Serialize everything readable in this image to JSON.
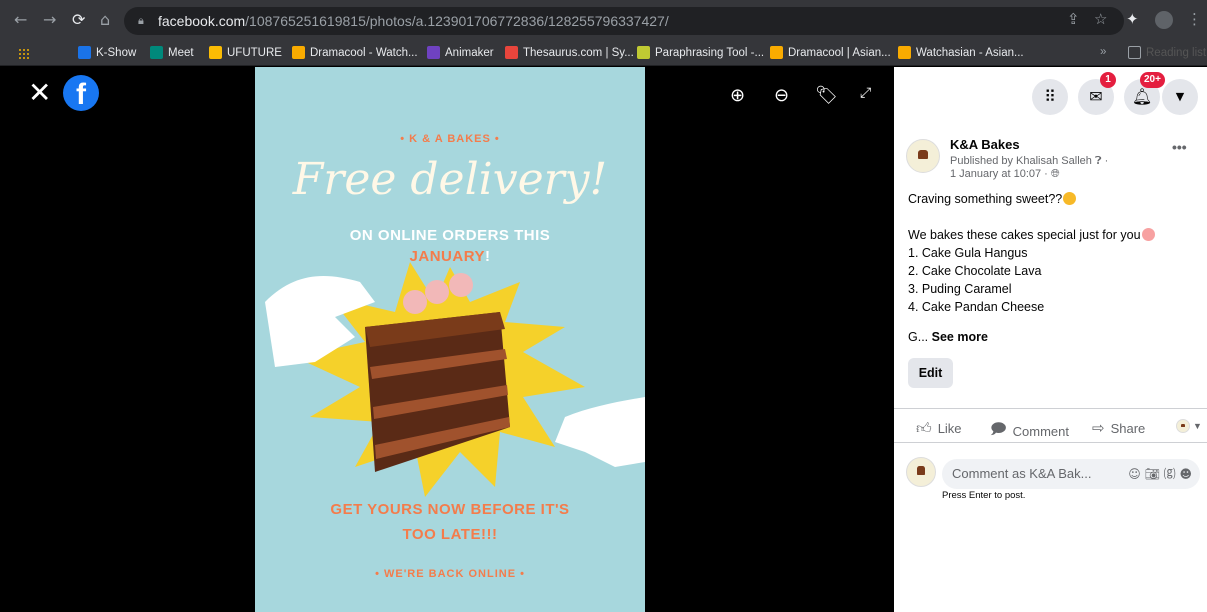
{
  "browser": {
    "url_domain": "facebook.com",
    "url_path": "/108765251619815/photos/a.123901706772836/128255796337427/",
    "bookmarks": [
      {
        "label": "Apps",
        "color": "#f4b400"
      },
      {
        "label": "K-Show",
        "color": "#1a73e8"
      },
      {
        "label": "Meet",
        "color": "#00897b"
      },
      {
        "label": "UFUTURE",
        "color": "#fbbc04"
      },
      {
        "label": "Dramacool - Watch...",
        "color": "#f9ab00"
      },
      {
        "label": "Animaker",
        "color": "#6f42c1"
      },
      {
        "label": "Thesaurus.com | Sy...",
        "color": "#e8453c"
      },
      {
        "label": "Paraphrasing Tool -...",
        "color": "#c0ca33"
      },
      {
        "label": "Dramacool | Asian...",
        "color": "#f9ab00"
      },
      {
        "label": "Watchasian - Asian...",
        "color": "#f9ab00"
      }
    ],
    "reading_list": "Reading list"
  },
  "viewer": {
    "icons": [
      "close-icon",
      "facebook-logo",
      "zoom-in-icon",
      "zoom-out-icon",
      "tag-icon",
      "fullscreen-icon"
    ],
    "poster": {
      "brand": "• K & A BAKES •",
      "headline": "Free delivery!",
      "subline_white": "ON ONLINE ORDERS THIS",
      "subline_orange": "JANUARY",
      "subline_end": "!",
      "cta_line1": "GET YOURS NOW BEFORE IT'S",
      "cta_line2": "TOO LATE!!!",
      "footer": "• WE'RE BACK ONLINE •"
    }
  },
  "panel": {
    "messenger_badge": "1",
    "notifications_badge": "20+",
    "page_name": "K&A Bakes",
    "published_by": "Published by Khalisah Salleh",
    "date": "1 January at 10:07 ·",
    "more": "•••",
    "post_lines": [
      "Craving something sweet??",
      "",
      "We bakes these cakes special just for you",
      "1. Cake Gula Hangus",
      "2. Cake Chocolate Lava",
      "3. Puding Caramel",
      "4. Cake Pandan Cheese"
    ],
    "see_more_prefix": "G...",
    "see_more": "See more",
    "edit": "Edit",
    "like": "Like",
    "comment": "Comment",
    "share": "Share",
    "comment_placeholder": "Comment as K&A Bak...",
    "press_enter": "Press Enter to post."
  }
}
